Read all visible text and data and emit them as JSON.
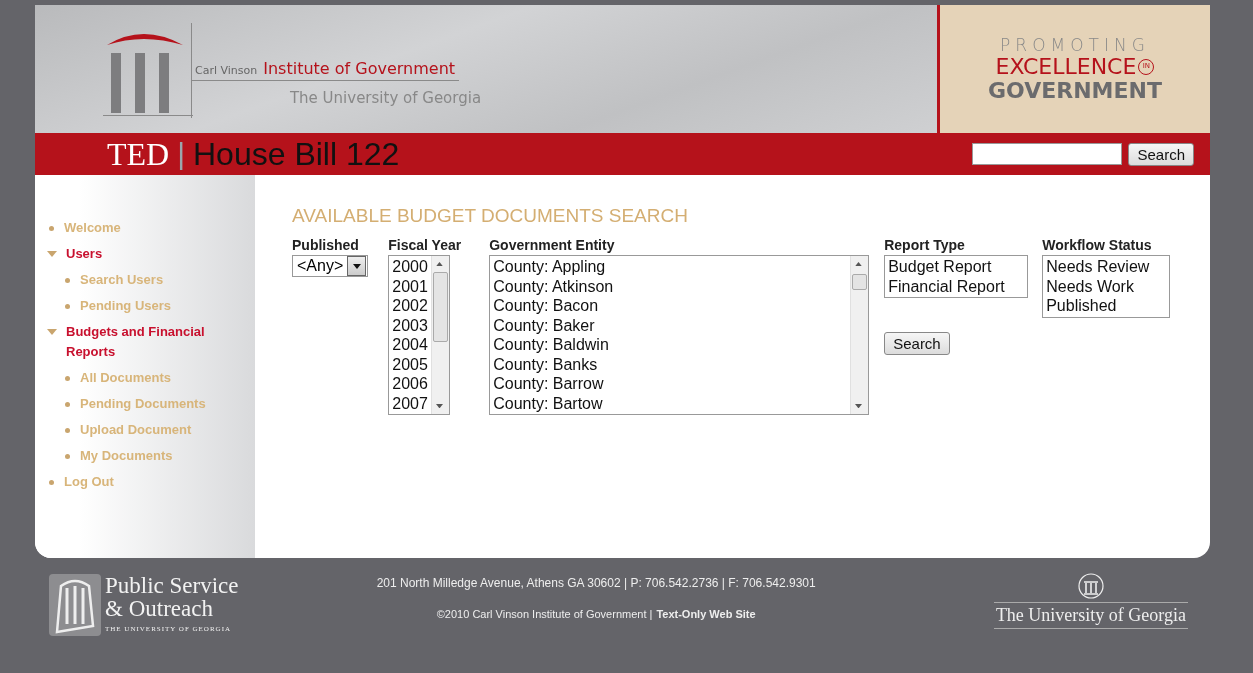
{
  "header": {
    "institute_prefix": "Carl Vinson",
    "institute_name": "Institute of Government",
    "university": "The University of Georgia",
    "slogan": [
      "PROMOTING",
      "EXCELLENCE",
      "IN",
      "GOVERNMENT"
    ]
  },
  "title_bar": {
    "brand": "TED",
    "separator": "|",
    "title": "House Bill 122",
    "search": {
      "button": "Search"
    }
  },
  "sidebar": {
    "items": [
      {
        "label": "Welcome",
        "kind": "link"
      },
      {
        "label": "Users",
        "kind": "section",
        "expanded": true,
        "children": [
          {
            "label": "Search Users",
            "kind": "link"
          },
          {
            "label": "Pending Users",
            "kind": "link"
          }
        ]
      },
      {
        "label": "Budgets and Financial Reports",
        "kind": "section",
        "expanded": true,
        "children": [
          {
            "label": "All Documents",
            "kind": "link"
          },
          {
            "label": "Pending Documents",
            "kind": "link"
          },
          {
            "label": "Upload Document",
            "kind": "link"
          },
          {
            "label": "My Documents",
            "kind": "link"
          }
        ]
      },
      {
        "label": "Log Out",
        "kind": "link"
      }
    ]
  },
  "search_form": {
    "heading": "AVAILABLE BUDGET DOCUMENTS SEARCH",
    "published": {
      "label": "Published",
      "value": "<Any>"
    },
    "fiscal_year": {
      "label": "Fiscal Year",
      "options": [
        {
          "text": "2000",
          "selected": false
        },
        {
          "text": "2001",
          "selected": false
        },
        {
          "text": "2002",
          "selected": false
        },
        {
          "text": "2003",
          "selected": false
        },
        {
          "text": "2004",
          "selected": false
        },
        {
          "text": "2005",
          "selected": false
        },
        {
          "text": "2006",
          "selected": false
        },
        {
          "text": "2007",
          "selected": false
        }
      ]
    },
    "government_entity": {
      "label": "Government Entity",
      "options": [
        {
          "text": "County: Appling",
          "selected": false
        },
        {
          "text": "County: Atkinson",
          "selected": false
        },
        {
          "text": "County: Bacon",
          "selected": false
        },
        {
          "text": "County: Baker",
          "selected": false
        },
        {
          "text": "County: Baldwin",
          "selected": false
        },
        {
          "text": "County: Banks",
          "selected": false
        },
        {
          "text": "County: Barrow",
          "selected": false
        },
        {
          "text": "County: Bartow",
          "selected": false
        }
      ]
    },
    "report_type": {
      "label": "Report Type",
      "options": [
        {
          "text": "Budget Report",
          "selected": false
        },
        {
          "text": "Financial Report",
          "selected": false
        }
      ]
    },
    "workflow_status": {
      "label": "Workflow Status",
      "options": [
        {
          "text": "Needs Review",
          "selected": false
        },
        {
          "text": "Needs Work",
          "selected": false
        },
        {
          "text": "Published",
          "selected": false
        }
      ]
    },
    "search_button": "Search"
  },
  "footer": {
    "psa_lines": [
      "Public Service",
      "& Outreach"
    ],
    "psa_sub": "THE UNIVERSITY OF GEORGIA",
    "address": "201 North Milledge Avenue, Athens GA 30602 | P: 706.542.2736 | F: 706.542.9301",
    "copyright": "©2010 Carl Vinson Institute of Government |",
    "text_only_link": "Text-Only Web Site",
    "uga": "The University of Georgia"
  }
}
